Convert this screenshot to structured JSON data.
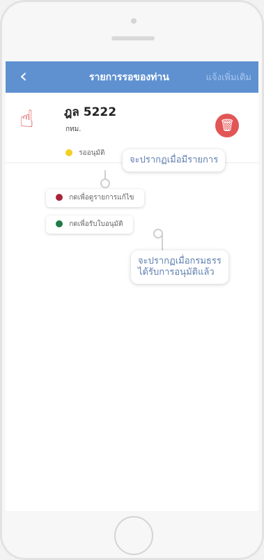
{
  "colors": {
    "nav_bar": "#5f91d1",
    "hand_icon": "#d8484b",
    "delete_button": "#e25656",
    "status_pending": "#f3d021",
    "status_problem": "#a8243b",
    "status_approved": "#1f7a45"
  },
  "nav": {
    "back_icon": "back-arrow-icon",
    "title": "รายการรอของท่าน",
    "action": "แจ้งเพิ่มเติม"
  },
  "list_item": {
    "plate": "ฎล 5222",
    "province": "กทม.",
    "status_label": "รออนุมัติ",
    "hand_icon": "pointing-hand-icon",
    "delete_icon": "trash-icon"
  },
  "status_menu": {
    "items": [
      {
        "label": "กดเพื่อดูรายการแก้ไข"
      },
      {
        "label": "กดเพื่อรับใบอนุมัติ"
      }
    ]
  },
  "callouts": {
    "first": "จะปรากฏเมื่อมีรายการ",
    "second_line1": "จะปรากฏเมื่อกรมธรร",
    "second_line2": "ได้รับการอนุมัติแล้ว"
  }
}
